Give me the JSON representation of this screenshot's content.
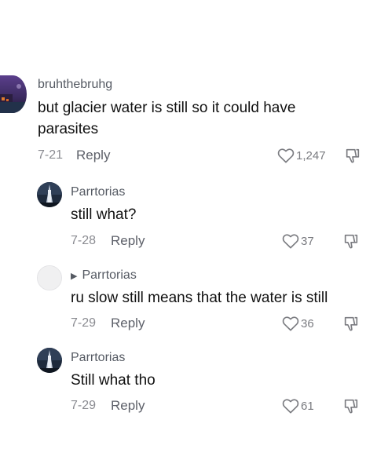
{
  "comments": [
    {
      "username": "bruhthebruhg",
      "text": "but glacier water is still so it could have parasites",
      "date": "7-21",
      "reply_label": "Reply",
      "likes": "1,247",
      "avatar": "purple-night-scene-icon"
    },
    {
      "username": "Parrtorias",
      "text": "still what?",
      "date": "7-28",
      "reply_label": "Reply",
      "likes": "37",
      "avatar": "tower-at-night-icon"
    },
    {
      "username": "Parrtorias",
      "text": "ru slow still means that the water is still",
      "date": "7-29",
      "reply_label": "Reply",
      "likes": "36",
      "avatar": "blank-avatar-icon"
    },
    {
      "username": "Parrtorias",
      "text": "Still what tho",
      "date": "7-29",
      "reply_label": "Reply",
      "likes": "61",
      "avatar": "tower-at-night-icon"
    }
  ]
}
